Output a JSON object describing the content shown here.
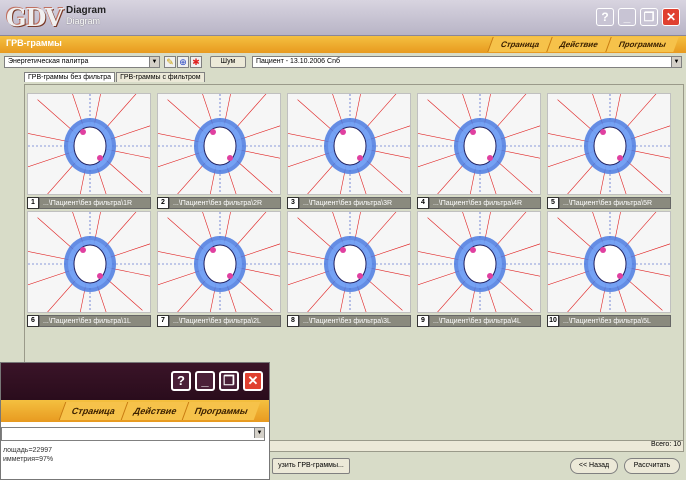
{
  "app": {
    "logo": "GDV",
    "name_top": "Diagram",
    "name_bottom": "Diagram"
  },
  "window": {
    "help": "?",
    "minimize": "_",
    "maximize": "❐",
    "close": "✕"
  },
  "section_title": "ГРВ-граммы",
  "menu": [
    "Страница",
    "Действие",
    "Программы"
  ],
  "toolbar": {
    "palette": "Энергетическая палитра",
    "noise_button": "Шум",
    "patient": "Пациент - 13.10.2006 Cnб"
  },
  "tabs": [
    "ГРВ-граммы без фильтра",
    "ГРВ-граммы с фильтром"
  ],
  "cells": [
    {
      "num": "1",
      "path": "...\\Пациент\\без фильтра\\1R"
    },
    {
      "num": "2",
      "path": "...\\Пациент\\без фильтра\\2R"
    },
    {
      "num": "3",
      "path": "...\\Пациент\\без фильтра\\3R"
    },
    {
      "num": "4",
      "path": "...\\Пациент\\без фильтра\\4R"
    },
    {
      "num": "5",
      "path": "...\\Пациент\\без фильтра\\5R"
    },
    {
      "num": "6",
      "path": "...\\Пациент\\без фильтра\\1L"
    },
    {
      "num": "7",
      "path": "...\\Пациент\\без фильтра\\2L"
    },
    {
      "num": "8",
      "path": "...\\Пациент\\без фильтра\\3L"
    },
    {
      "num": "9",
      "path": "...\\Пациент\\без фильтра\\4L"
    },
    {
      "num": "10",
      "path": "...\\Пациент\\без фильтра\\5L"
    }
  ],
  "status": {
    "total": "Всего: 10"
  },
  "bottom": {
    "load": "узить ГРВ-граммы...",
    "back": "<< Назад",
    "calc": "Рассчитать"
  },
  "sub": {
    "menu": [
      "Страница",
      "Действие",
      "Программы"
    ],
    "line1": "лощадь=22997",
    "line2": "имметрия=97%"
  }
}
